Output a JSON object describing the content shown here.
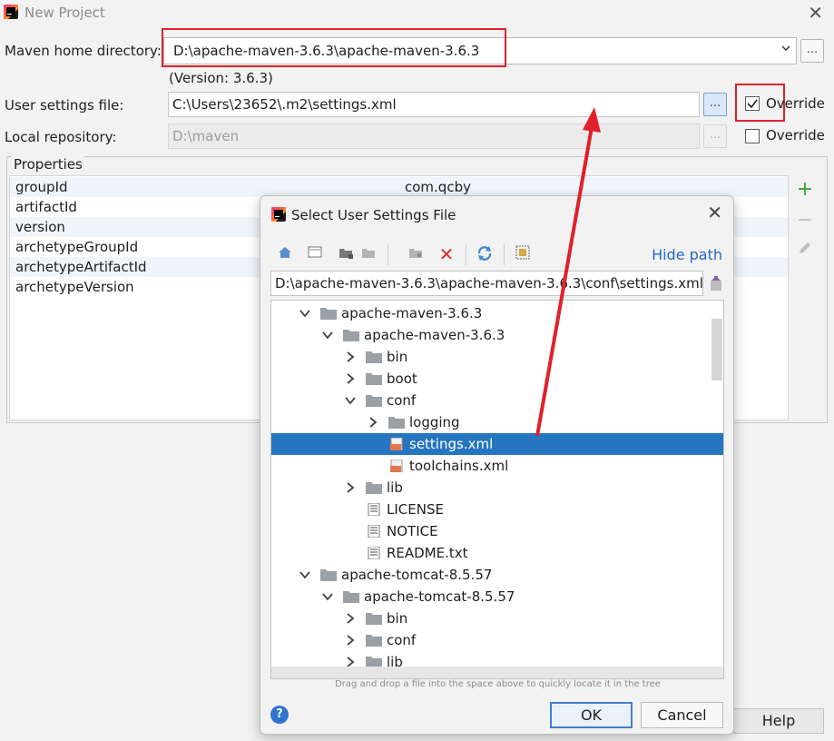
{
  "window": {
    "title": "New Project"
  },
  "maven": {
    "home_label": "Maven home directory:",
    "home_value": "D:\\apache-maven-3.6.3\\apache-maven-3.6.3",
    "version_text": "(Version: 3.6.3)",
    "settings_label": "User settings file:",
    "settings_value": "C:\\Users\\23652\\.m2\\settings.xml",
    "repo_label": "Local repository:",
    "repo_value": "D:\\maven",
    "override_label": "Override",
    "override_settings_checked": true,
    "override_repo_checked": false,
    "browse_label": "..."
  },
  "properties": {
    "title": "Properties",
    "rows": [
      {
        "key": "groupId",
        "value": "com.qcby"
      },
      {
        "key": "artifactId",
        "value": ""
      },
      {
        "key": "version",
        "value": ""
      },
      {
        "key": "archetypeGroupId",
        "value": ""
      },
      {
        "key": "archetypeArtifactId",
        "value": ""
      },
      {
        "key": "archetypeVersion",
        "value": ""
      }
    ]
  },
  "footer": {
    "help_label": "Help"
  },
  "dialog": {
    "title": "Select User Settings File",
    "hide_path_label": "Hide path",
    "path_value": "D:\\apache-maven-3.6.3\\apache-maven-3.6.3\\conf\\settings.xml",
    "tree": [
      {
        "label": "apache-maven-3.6.3",
        "type": "folder",
        "level": 0,
        "expanded": true
      },
      {
        "label": "apache-maven-3.6.3",
        "type": "folder",
        "level": 1,
        "expanded": true
      },
      {
        "label": "bin",
        "type": "folder",
        "level": 2,
        "expanded": false
      },
      {
        "label": "boot",
        "type": "folder",
        "level": 2,
        "expanded": false
      },
      {
        "label": "conf",
        "type": "folder",
        "level": 2,
        "expanded": true
      },
      {
        "label": "logging",
        "type": "folder",
        "level": 3,
        "expanded": false
      },
      {
        "label": "settings.xml",
        "type": "xml",
        "level": 3,
        "selected": true
      },
      {
        "label": "toolchains.xml",
        "type": "xml",
        "level": 3
      },
      {
        "label": "lib",
        "type": "folder",
        "level": 2,
        "expanded": false
      },
      {
        "label": "LICENSE",
        "type": "text",
        "level": 2
      },
      {
        "label": "NOTICE",
        "type": "text",
        "level": 2
      },
      {
        "label": "README.txt",
        "type": "text",
        "level": 2
      },
      {
        "label": "apache-tomcat-8.5.57",
        "type": "folder",
        "level": 0,
        "expanded": true
      },
      {
        "label": "apache-tomcat-8.5.57",
        "type": "folder",
        "level": 1,
        "expanded": true
      },
      {
        "label": "bin",
        "type": "folder",
        "level": 2,
        "expanded": false
      },
      {
        "label": "conf",
        "type": "folder",
        "level": 2,
        "expanded": false
      },
      {
        "label": "lib",
        "type": "folder",
        "level": 2,
        "expanded": false
      },
      {
        "label": "l",
        "type": "folder",
        "level": 2,
        "expanded": false
      }
    ],
    "hint": "Drag and drop a file into the space above to quickly locate it in the tree",
    "ok_label": "OK",
    "cancel_label": "Cancel",
    "help_icon_label": "?"
  },
  "colors": {
    "selection": "#2675bf",
    "annotation_red": "#e0202b",
    "link_blue": "#2567c4"
  }
}
